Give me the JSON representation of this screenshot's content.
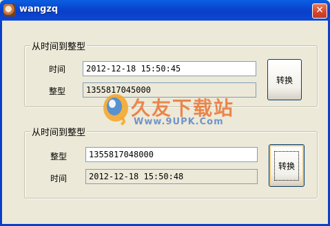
{
  "window": {
    "title": "wangzq",
    "close_glyph": "✕",
    "icon": "app-icon"
  },
  "group_top": {
    "title": "从时间到整型",
    "time_label": "时间",
    "time_value": "2012-12-18 15:50:45",
    "int_label": "整型",
    "int_value": "1355817045000",
    "convert_label": "转换"
  },
  "group_bottom": {
    "title": "从时间到整型",
    "int_label": "整型",
    "int_value": "1355817048000",
    "time_label": "时间",
    "time_value": "2012-12-18 15:50:48",
    "convert_label": "转换"
  },
  "watermark": {
    "text": "久友下载站",
    "url": "Www.9UPK.Com"
  },
  "colors": {
    "titlebar": "#0a46d0",
    "window_bg": "#ece9d8",
    "input_border": "#7f9db9",
    "close_btn": "#d5442b"
  }
}
